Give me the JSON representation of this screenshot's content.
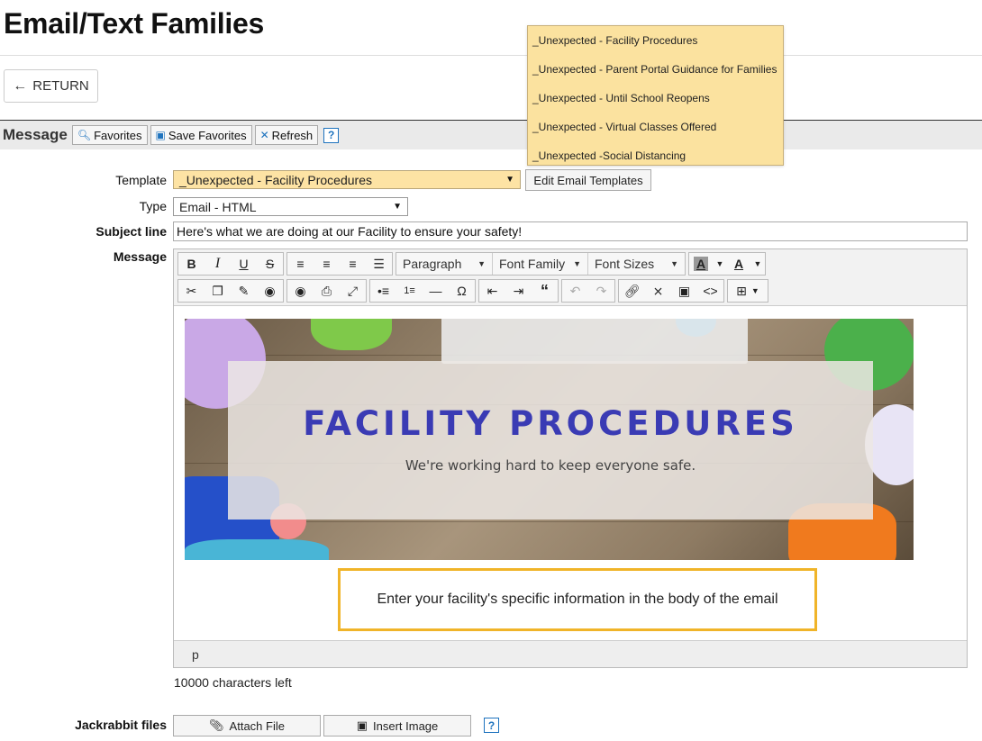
{
  "page": {
    "title": "Email/Text Families"
  },
  "return_button": {
    "label": "RETURN"
  },
  "message_bar": {
    "label": "Message",
    "buttons": {
      "favorites": "Favorites",
      "save_favorites": "Save Favorites",
      "refresh": "Refresh"
    },
    "help": "?"
  },
  "form": {
    "template": {
      "label": "Template",
      "value": "_Unexpected - Facility Procedures"
    },
    "edit_templates_label": "Edit Email Templates",
    "type": {
      "label": "Type",
      "value": "Email - HTML"
    },
    "subject": {
      "label": "Subject line",
      "value": "Here's what we are doing at our Facility to ensure your safety!"
    },
    "message_label": "Message"
  },
  "toolbar": {
    "paragraph": "Paragraph",
    "font_family": "Font Family",
    "font_sizes": "Font Sizes"
  },
  "editor": {
    "banner_title": "FACILITY PROCEDURES",
    "banner_subtitle": "We're working hard to keep everyone safe.",
    "callout": "Enter your facility's specific information in the body of the email",
    "status_path": "p"
  },
  "chars_left": "10000 characters left",
  "files": {
    "label": "Jackrabbit files",
    "attach_label": "Attach File",
    "insert_image_label": "Insert Image",
    "help": "?"
  },
  "template_dropdown": {
    "options": [
      "_Unexpected - Facility Procedures",
      "_Unexpected - Parent Portal Guidance for Families",
      "_Unexpected - Until School Reopens",
      "_Unexpected - Virtual Classes Offered",
      "_Unexpected -Social Distancing"
    ]
  },
  "colors": {
    "dropdown_bg": "#fbe29f",
    "accent_blue": "#1e73be",
    "callout_border": "#f0b429",
    "banner_title": "#3a3bb4"
  }
}
